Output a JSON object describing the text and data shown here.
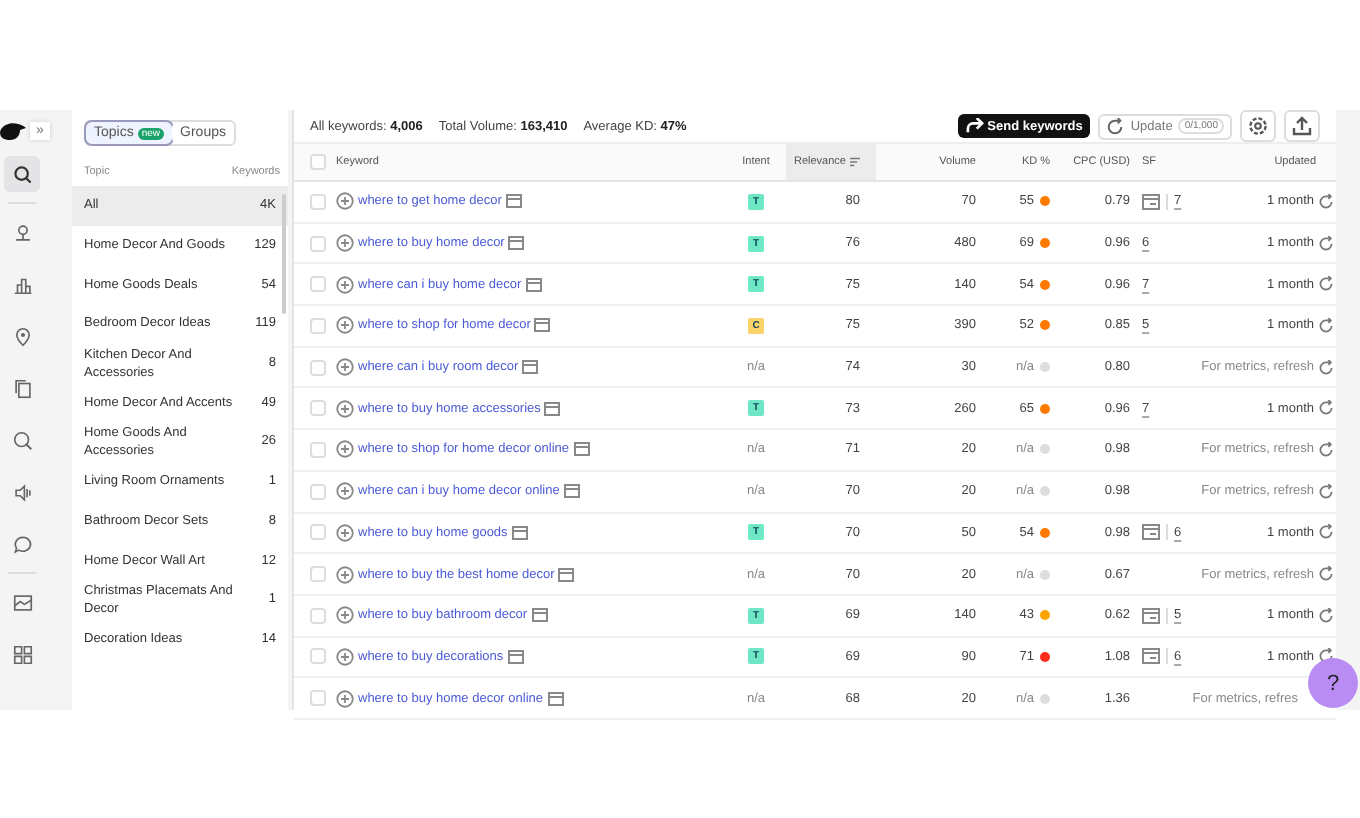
{
  "sidebar": {
    "expand_label": "»",
    "items": [
      {
        "kind": "keyword",
        "selected": true
      },
      {
        "kind": "pin"
      },
      {
        "kind": "bars"
      },
      {
        "kind": "location"
      },
      {
        "kind": "copy"
      },
      {
        "kind": "search"
      },
      {
        "kind": "speaker"
      },
      {
        "kind": "chat"
      },
      {
        "kind": "image"
      },
      {
        "kind": "grid"
      }
    ]
  },
  "topic_tabs": [
    {
      "label": "Topics",
      "badge": "new",
      "selected": true
    },
    {
      "label": "Groups",
      "selected": false
    }
  ],
  "topics": {
    "columns": [
      "Topic",
      "Keywords"
    ],
    "rows": [
      {
        "name": "All",
        "count": "4K",
        "selected": true
      },
      {
        "name": "Home Decor And Goods",
        "count": "129",
        "selected": false
      },
      {
        "name": "Home Goods Deals",
        "count": "54",
        "selected": false
      },
      {
        "name": "Bedroom Decor Ideas",
        "count": "119",
        "selected": false
      },
      {
        "name": "Kitchen Decor And Accessories",
        "count": "8",
        "selected": false
      },
      {
        "name": "Home Decor And Accents",
        "count": "49",
        "selected": false
      },
      {
        "name": "Home Goods And Accessories",
        "count": "26",
        "selected": false
      },
      {
        "name": "Living Room Ornaments",
        "count": "1",
        "selected": false
      },
      {
        "name": "Bathroom Decor Sets",
        "count": "8",
        "selected": false
      },
      {
        "name": "Home Decor Wall Art",
        "count": "12",
        "selected": false
      },
      {
        "name": "Christmas Placemats And Decor",
        "count": "1",
        "selected": false
      },
      {
        "name": "Decoration Ideas",
        "count": "14",
        "selected": false
      }
    ]
  },
  "summary": [
    {
      "label": "All keywords:",
      "value": "4,006"
    },
    {
      "label": "Total Volume:",
      "value": "163,410"
    },
    {
      "label": "Average KD:",
      "value": "47%"
    }
  ],
  "toolbar": {
    "send_label": "Send keywords",
    "update_label": "Update",
    "update_count": "0/1,000"
  },
  "table": {
    "all_checked": false,
    "columns": [
      {
        "label": "Keyword",
        "sorted": false
      },
      {
        "label": "Intent",
        "sorted": false
      },
      {
        "label": "Relevance",
        "sorted": true
      },
      {
        "label": "Volume",
        "sorted": false
      },
      {
        "label": "KD %",
        "sorted": false
      },
      {
        "label": "CPC (USD)",
        "sorted": false
      },
      {
        "label": "SF",
        "sorted": false
      },
      {
        "label": "Updated",
        "sorted": false
      }
    ],
    "rows": [
      {
        "checked": false,
        "keyword": "where to get home decor",
        "intent": {
          "kind": "badge",
          "label": "T",
          "color": "#6ee7c5"
        },
        "relevance": "80",
        "volume": "70",
        "kd": "55",
        "color": "#ff7a00",
        "cpc": "0.79",
        "sf_icon": true,
        "sf": "7",
        "updated": "1 month",
        "refresh_icon": true
      },
      {
        "checked": false,
        "keyword": "where to buy home decor",
        "intent": {
          "kind": "badge",
          "label": "T",
          "color": "#6ee7c5"
        },
        "relevance": "76",
        "volume": "480",
        "kd": "69",
        "color": "#ff7a00",
        "cpc": "0.96",
        "sf_icon": false,
        "sf": "6",
        "updated": "1 month",
        "refresh_icon": true
      },
      {
        "checked": false,
        "keyword": "where can i buy home decor",
        "intent": {
          "kind": "badge",
          "label": "T",
          "color": "#6ee7c5"
        },
        "relevance": "75",
        "volume": "140",
        "kd": "54",
        "color": "#ff7a00",
        "cpc": "0.96",
        "sf_icon": false,
        "sf": "7",
        "updated": "1 month",
        "refresh_icon": true
      },
      {
        "checked": false,
        "keyword": "where to shop for home decor",
        "intent": {
          "kind": "badge",
          "label": "C",
          "color": "#fcd36a"
        },
        "relevance": "75",
        "volume": "390",
        "kd": "52",
        "color": "#ff7a00",
        "cpc": "0.85",
        "sf_icon": false,
        "sf": "5",
        "updated": "1 month",
        "refresh_icon": true
      },
      {
        "checked": false,
        "keyword": "where can i buy room decor",
        "intent": {
          "kind": "text",
          "label": "n/a"
        },
        "relevance": "74",
        "volume": "30",
        "kd": "n/a",
        "color": "#dddddd",
        "cpc": "0.80",
        "sf_icon": false,
        "updated": "For metrics, refresh",
        "refresh_icon": true
      },
      {
        "checked": false,
        "keyword": "where to buy home accessories",
        "intent": {
          "kind": "badge",
          "label": "T",
          "color": "#6ee7c5"
        },
        "relevance": "73",
        "volume": "260",
        "kd": "65",
        "color": "#ff7a00",
        "cpc": "0.96",
        "sf_icon": false,
        "sf": "7",
        "updated": "1 month",
        "refresh_icon": true
      },
      {
        "checked": false,
        "keyword": "where to shop for home decor online",
        "intent": {
          "kind": "text",
          "label": "n/a"
        },
        "relevance": "71",
        "volume": "20",
        "kd": "n/a",
        "color": "#dddddd",
        "cpc": "0.98",
        "sf_icon": false,
        "updated": "For metrics, refresh",
        "refresh_icon": true
      },
      {
        "checked": false,
        "keyword": "where can i buy home decor online",
        "intent": {
          "kind": "text",
          "label": "n/a"
        },
        "relevance": "70",
        "volume": "20",
        "kd": "n/a",
        "color": "#dddddd",
        "cpc": "0.98",
        "sf_icon": false,
        "updated": "For metrics, refresh",
        "refresh_icon": true
      },
      {
        "checked": false,
        "keyword": "where to buy home goods",
        "intent": {
          "kind": "badge",
          "label": "T",
          "color": "#6ee7c5"
        },
        "relevance": "70",
        "volume": "50",
        "kd": "54",
        "color": "#ff7a00",
        "cpc": "0.98",
        "sf_icon": true,
        "sf": "6",
        "updated": "1 month",
        "refresh_icon": true
      },
      {
        "checked": false,
        "keyword": "where to buy the best home decor",
        "intent": {
          "kind": "text",
          "label": "n/a"
        },
        "relevance": "70",
        "volume": "20",
        "kd": "n/a",
        "color": "#dddddd",
        "cpc": "0.67",
        "sf_icon": false,
        "updated": "For metrics, refresh",
        "refresh_icon": true
      },
      {
        "checked": false,
        "keyword": "where to buy bathroom decor",
        "intent": {
          "kind": "badge",
          "label": "T",
          "color": "#6ee7c5"
        },
        "relevance": "69",
        "volume": "140",
        "kd": "43",
        "color": "#ffa400",
        "cpc": "0.62",
        "sf_icon": true,
        "sf": "5",
        "updated": "1 month",
        "refresh_icon": true
      },
      {
        "checked": false,
        "keyword": "where to buy decorations",
        "intent": {
          "kind": "badge",
          "label": "T",
          "color": "#6ee7c5"
        },
        "relevance": "69",
        "volume": "90",
        "kd": "71",
        "color": "#ff2a1a",
        "cpc": "1.08",
        "sf_icon": true,
        "sf": "6",
        "updated": "1 month",
        "refresh_icon": true
      },
      {
        "checked": false,
        "keyword": "where to buy home decor online",
        "intent": {
          "kind": "text",
          "label": "n/a"
        },
        "relevance": "68",
        "volume": "20",
        "kd": "n/a",
        "color": "#dddddd",
        "cpc": "1.36",
        "sf_icon": false,
        "updated": "For metrics, refres",
        "refresh_icon": false
      }
    ]
  },
  "help_label": "?"
}
